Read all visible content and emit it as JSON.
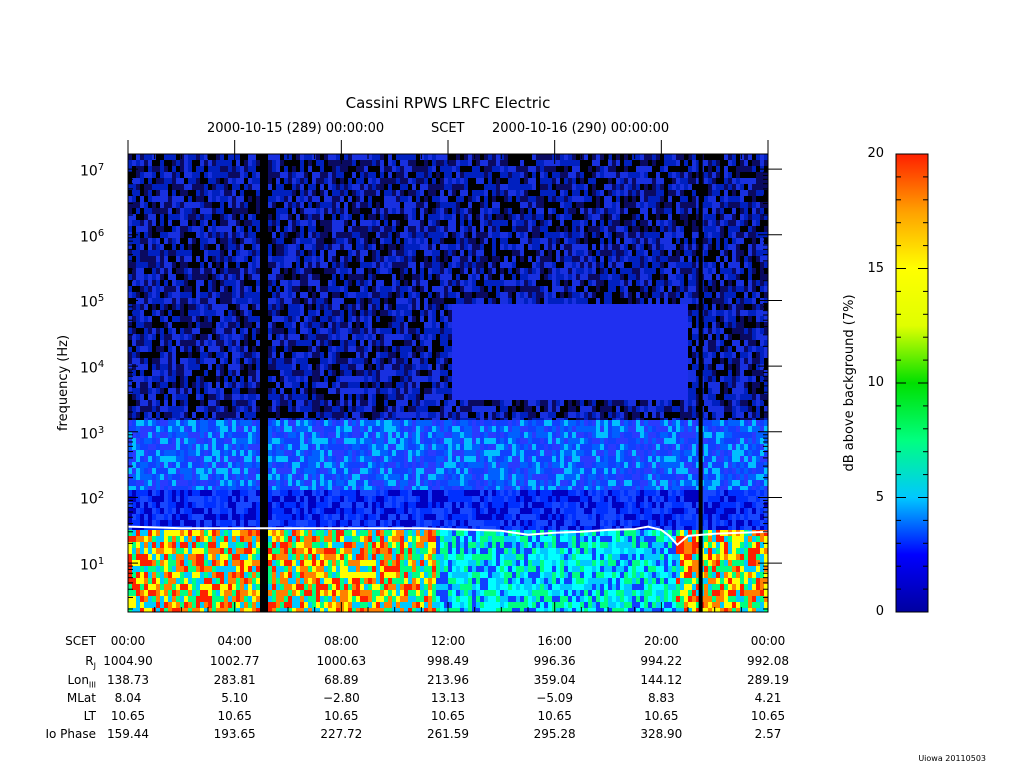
{
  "chart_data": {
    "type": "heatmap",
    "title": "Cassini RPWS LRFC Electric",
    "subtitle": {
      "start": "2000-10-15 (289) 00:00:00",
      "mid": "SCET",
      "end": "2000-10-16 (290) 00:00:00"
    },
    "ylabel": "frequency (Hz)",
    "y_scale": "log",
    "y_ticks": [
      {
        "base": "10",
        "exp": "1",
        "value": 10
      },
      {
        "base": "10",
        "exp": "2",
        "value": 100
      },
      {
        "base": "10",
        "exp": "3",
        "value": 1000
      },
      {
        "base": "10",
        "exp": "4",
        "value": 10000
      },
      {
        "base": "10",
        "exp": "5",
        "value": 100000
      },
      {
        "base": "10",
        "exp": "6",
        "value": 1000000
      },
      {
        "base": "10",
        "exp": "7",
        "value": 10000000
      }
    ],
    "colorbar": {
      "label": "dB above background (7%)",
      "ticks": [
        "0",
        "5",
        "10",
        "15",
        "20"
      ],
      "range": [
        0,
        20
      ],
      "colors": [
        "#0000a0",
        "#0000ff",
        "#00c8ff",
        "#00ff80",
        "#00e000",
        "#e0ff00",
        "#ffff00",
        "#ffa000",
        "#ff2000"
      ]
    },
    "line_series": {
      "color": "#ffffff",
      "x_hours": [
        0,
        1,
        2,
        3,
        4,
        5,
        6,
        7,
        8,
        9,
        10,
        11,
        12,
        13,
        14,
        15,
        16,
        17,
        18,
        19,
        19.5,
        20,
        20.3,
        20.6,
        21,
        22,
        23,
        24
      ],
      "y_hz": [
        36,
        35,
        34,
        34,
        34,
        34,
        34,
        34,
        34,
        34,
        34,
        34,
        33,
        32,
        31,
        27,
        29,
        30,
        32,
        33,
        36,
        32,
        26,
        19,
        26,
        28,
        29,
        30
      ]
    },
    "data_gaps": [
      {
        "start_hour": 4.95,
        "end_hour": 5.25
      },
      {
        "start_hour": 21.4,
        "end_hour": 21.55
      }
    ],
    "x_table": {
      "labels": [
        "SCET",
        "R",
        "Lon",
        "MLat",
        "LT",
        "Io Phase"
      ],
      "label_subscripts": [
        "",
        "J",
        "III",
        "",
        "",
        ""
      ],
      "columns": [
        {
          "hours": 0,
          "values": [
            "00:00",
            "1004.90",
            "138.73",
            "8.04",
            "10.65",
            "159.44"
          ]
        },
        {
          "hours": 4,
          "values": [
            "04:00",
            "1002.77",
            "283.81",
            "5.10",
            "10.65",
            "193.65"
          ]
        },
        {
          "hours": 8,
          "values": [
            "08:00",
            "1000.63",
            "68.89",
            "−2.80",
            "10.65",
            "227.72"
          ]
        },
        {
          "hours": 12,
          "values": [
            "12:00",
            "998.49",
            "213.96",
            "13.13",
            "10.65",
            "261.59"
          ]
        },
        {
          "hours": 16,
          "values": [
            "16:00",
            "996.36",
            "359.04",
            "−5.09",
            "10.65",
            "295.28"
          ]
        },
        {
          "hours": 20,
          "values": [
            "20:00",
            "994.22",
            "144.12",
            "8.83",
            "10.65",
            "328.90"
          ]
        },
        {
          "hours": 24,
          "values": [
            "00:00",
            "992.08",
            "289.19",
            "4.21",
            "10.65",
            "2.57"
          ]
        }
      ]
    }
  },
  "footer": {
    "stamp": "Uiowa 20110503"
  }
}
